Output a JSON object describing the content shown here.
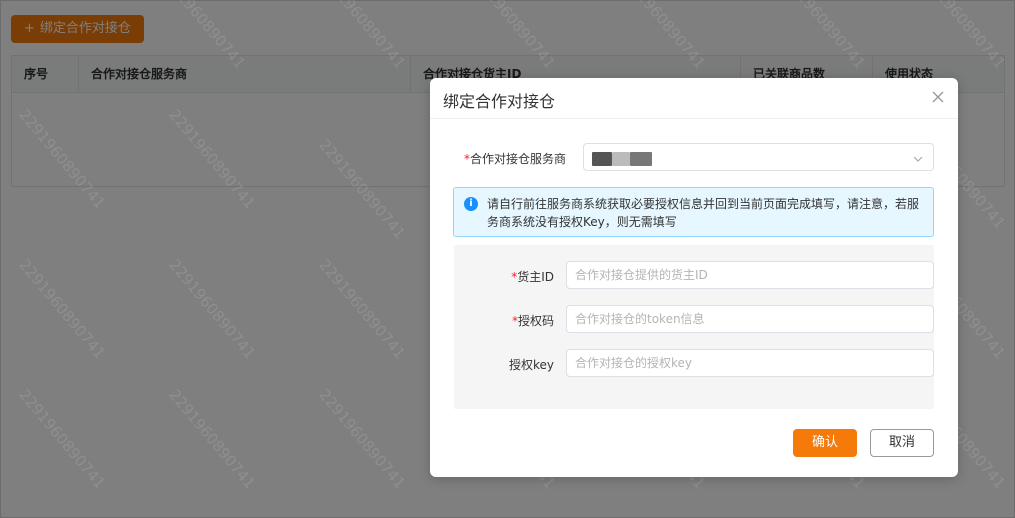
{
  "page": {
    "bind_button_label": "绑定合作对接仓",
    "bind_button_icon": "plus-icon",
    "table": {
      "columns": [
        "序号",
        "合作对接仓服务商",
        "合作对接仓货主ID",
        "已关联商品数",
        "使用状态"
      ]
    }
  },
  "watermark_text": "2291960890741",
  "modal": {
    "title": "绑定合作对接仓",
    "close_icon": "close-icon",
    "provider": {
      "label": "合作对接仓服务商",
      "required_mark": "*"
    },
    "alert": {
      "icon": "info-icon",
      "text": "请自行前往服务商系统获取必要授权信息并回到当前页面完成填写，请注意，若服务商系统没有授权Key，则无需填写"
    },
    "fields": [
      {
        "label": "货主ID",
        "required_mark": "*",
        "placeholder": "合作对接仓提供的货主ID"
      },
      {
        "label": "授权码",
        "required_mark": "*",
        "placeholder": "合作对接仓的token信息"
      },
      {
        "label": "授权key",
        "required_mark": "",
        "placeholder": "合作对接仓的授权key"
      }
    ],
    "confirm_label": "确认",
    "cancel_label": "取消"
  },
  "colors": {
    "accent": "#f57a0a",
    "info": "#1890ff",
    "required": "#f5222d"
  }
}
